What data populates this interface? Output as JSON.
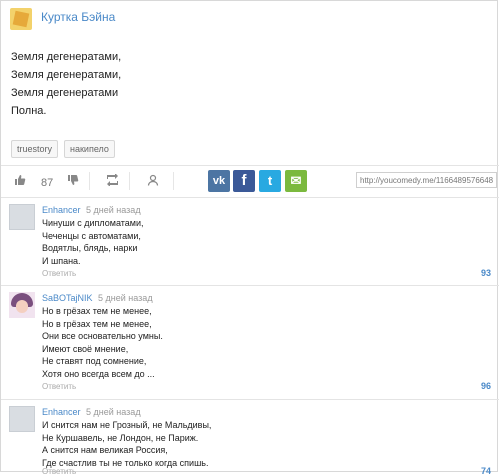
{
  "post": {
    "author": "Куртка Бэйна",
    "poem": [
      "Земля дегенератами,",
      "Земля дегенератами,",
      "Земля дегенератами",
      "Полна."
    ],
    "tags": [
      "truestory",
      "накипело"
    ]
  },
  "actions": {
    "rating": "87",
    "share": {
      "vk": "vk",
      "fb": "f",
      "tw": "t",
      "mail": "✉"
    },
    "link_value": "http://youcomedy.me/1166489576648"
  },
  "comments": [
    {
      "author": "Enhancer",
      "time": "5 дней назад",
      "lines": [
        "Чинуши с дипломатами,",
        "Чеченцы с автоматами,",
        "Водятлы, блядь, нарки",
        "И шпана."
      ],
      "reply": "Ответить",
      "score": "93"
    },
    {
      "author": "SaBOTajNIK",
      "time": "5 дней назад",
      "lines": [
        "Но в грёзах тем не менее,",
        "Но в грёзах тем не менее,",
        "Они все основательно умны.",
        "Имеют своё мнение,",
        "Не ставят под сомнение,",
        "Хотя оно всегда всем до ..."
      ],
      "reply": "Ответить",
      "score": "96"
    },
    {
      "author": "Enhancer",
      "time": "5 дней назад",
      "lines": [
        "И снится нам не Грозный, не Мальдивы,",
        "Не Куршавель, не Лондон, не Париж.",
        "А снится нам великая Россия,",
        "Где счастлив ты не только когда спишь."
      ],
      "reply": "Ответить",
      "score": "74"
    }
  ]
}
